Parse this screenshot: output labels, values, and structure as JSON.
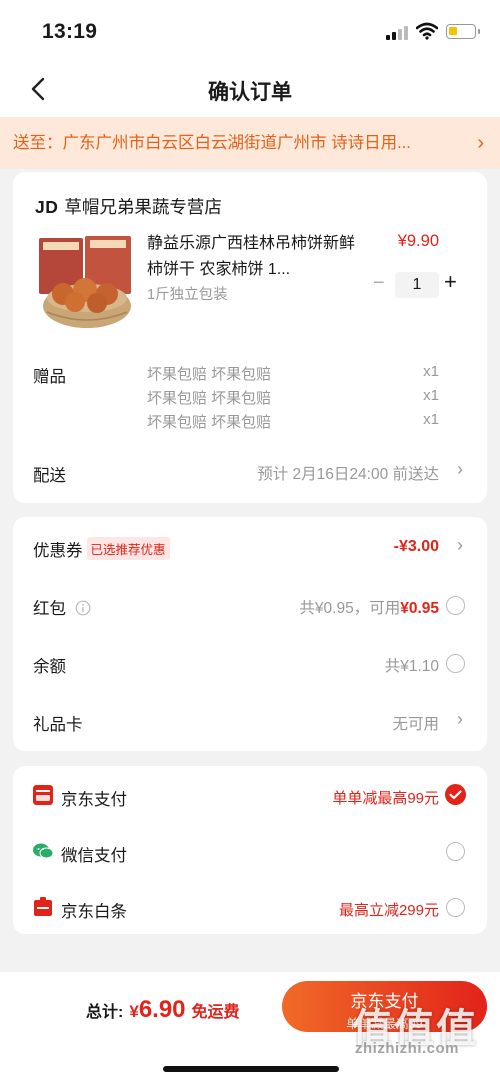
{
  "status_bar": {
    "time": "13:19"
  },
  "nav": {
    "title": "确认订单"
  },
  "address": {
    "text": "送至：广东广州市白云区白云湖街道广州市  诗诗日用...",
    "chevron": "›"
  },
  "store": {
    "logo": "JD",
    "name": "草帽兄弟果蔬专营店"
  },
  "product": {
    "name": "静益乐源广西桂林吊柿饼新鲜柿饼干 农家柿饼 1...",
    "spec": "1斤独立包装",
    "price": "¥9.90",
    "quantity": "1",
    "minus": "−",
    "plus": "+"
  },
  "gifts": {
    "label": "赠品",
    "items": [
      {
        "text": "坏果包赔 坏果包赔",
        "qty": "x1"
      },
      {
        "text": "坏果包赔 坏果包赔",
        "qty": "x1"
      },
      {
        "text": "坏果包赔 坏果包赔",
        "qty": "x1"
      }
    ]
  },
  "delivery": {
    "label": "配送",
    "value": "预计 2月16日24:00 前送达"
  },
  "coupon": {
    "label": "优惠券",
    "tag": "已选推荐优惠",
    "value": "-¥3.00"
  },
  "red_packet": {
    "label": "红包",
    "total": "共¥0.95，可用",
    "available": "¥0.95"
  },
  "balance": {
    "label": "余额",
    "value": "共¥1.10"
  },
  "gift_card": {
    "label": "礼品卡",
    "value": "无可用"
  },
  "payments": [
    {
      "label": "京东支付",
      "promo": "单单减最高99元",
      "selected": true
    },
    {
      "label": "微信支付",
      "promo": "",
      "selected": false
    },
    {
      "label": "京东白条",
      "promo": "最高立减299元",
      "selected": false
    }
  ],
  "footer": {
    "total_label": "总计:",
    "currency": "¥",
    "amount": "6.90",
    "shipping": "免运费",
    "pay_button": "京东支付",
    "pay_sub": "单单减最高99"
  },
  "watermark": {
    "main": "值值值",
    "site": "zhizhizhi.com"
  },
  "colors": {
    "accent": "#e2231a",
    "address_bg": "#fde8d9",
    "address_text": "#e2621b"
  }
}
